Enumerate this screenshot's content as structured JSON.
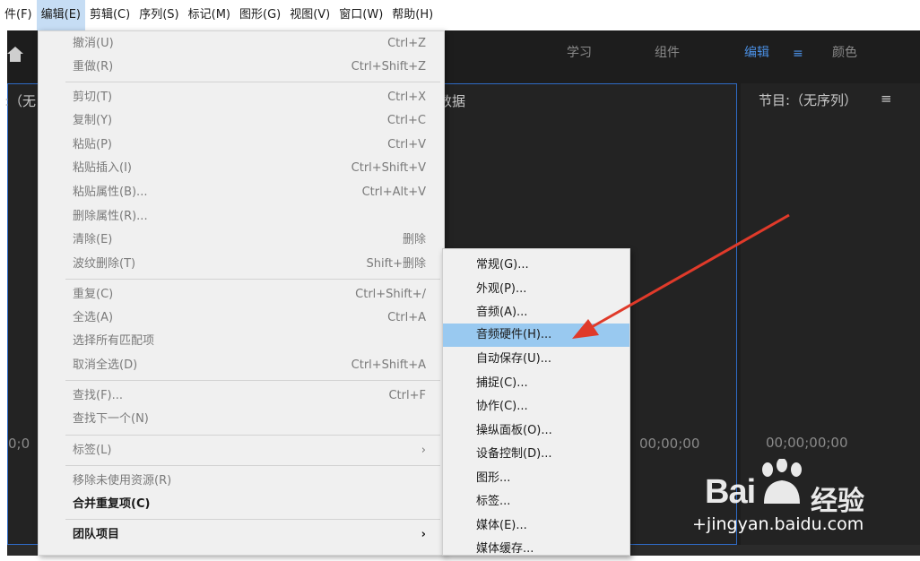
{
  "menubar": [
    "件(F)",
    "编辑(E)",
    "剪辑(C)",
    "序列(S)",
    "标记(M)",
    "图形(G)",
    "视图(V)",
    "窗口(W)",
    "帮助(H)"
  ],
  "workspaces": {
    "learn": "学习",
    "assembly": "组件",
    "editing": "编辑",
    "menu_glyph": "≡",
    "color": "颜色"
  },
  "panels": {
    "source_partial_title": ":（无",
    "metadata_partial": "数据",
    "program_title": "节目:（无序列）",
    "program_menu": "≡",
    "source_tc_left": "0;0",
    "source_tc_right": "00;00;00",
    "program_tc": "00;00;00;00"
  },
  "edit_menu": [
    {
      "label": "撤消(U)",
      "shortcut": "Ctrl+Z",
      "state": "disabled"
    },
    {
      "label": "重做(R)",
      "shortcut": "Ctrl+Shift+Z",
      "state": "disabled"
    },
    {
      "label": "剪切(T)",
      "shortcut": "Ctrl+X",
      "state": "disabled"
    },
    {
      "label": "复制(Y)",
      "shortcut": "Ctrl+C",
      "state": "disabled"
    },
    {
      "label": "粘贴(P)",
      "shortcut": "Ctrl+V",
      "state": "disabled"
    },
    {
      "label": "粘贴插入(I)",
      "shortcut": "Ctrl+Shift+V",
      "state": "disabled"
    },
    {
      "label": "粘贴属性(B)...",
      "shortcut": "Ctrl+Alt+V",
      "state": "disabled"
    },
    {
      "label": "删除属性(R)...",
      "shortcut": "",
      "state": "disabled"
    },
    {
      "label": "清除(E)",
      "shortcut": "删除",
      "state": "disabled"
    },
    {
      "label": "波纹删除(T)",
      "shortcut": "Shift+删除",
      "state": "disabled"
    },
    {
      "label": "重复(C)",
      "shortcut": "Ctrl+Shift+/",
      "state": "disabled"
    },
    {
      "label": "全选(A)",
      "shortcut": "Ctrl+A",
      "state": "disabled"
    },
    {
      "label": "选择所有匹配项",
      "shortcut": "",
      "state": "disabled"
    },
    {
      "label": "取消全选(D)",
      "shortcut": "Ctrl+Shift+A",
      "state": "disabled"
    },
    {
      "label": "查找(F)...",
      "shortcut": "Ctrl+F",
      "state": "disabled"
    },
    {
      "label": "查找下一个(N)",
      "shortcut": "",
      "state": "disabled"
    },
    {
      "label": "标签(L)",
      "shortcut": "›",
      "state": "disabled"
    },
    {
      "label": "移除未使用资源(R)",
      "shortcut": "",
      "state": "disabled"
    },
    {
      "label": "合并重复项(C)",
      "shortcut": "",
      "state": "enabled"
    },
    {
      "label": "团队项目",
      "shortcut": "›",
      "state": "enabled"
    }
  ],
  "preferences_submenu": [
    {
      "label": "常规(G)...",
      "highlighted": false
    },
    {
      "label": "外观(P)...",
      "highlighted": false
    },
    {
      "label": "音频(A)...",
      "highlighted": false
    },
    {
      "label": "音频硬件(H)...",
      "highlighted": true
    },
    {
      "label": "自动保存(U)...",
      "highlighted": false
    },
    {
      "label": "捕捉(C)...",
      "highlighted": false
    },
    {
      "label": "协作(C)...",
      "highlighted": false
    },
    {
      "label": "操纵面板(O)...",
      "highlighted": false
    },
    {
      "label": "设备控制(D)...",
      "highlighted": false
    },
    {
      "label": "图形...",
      "highlighted": false
    },
    {
      "label": "标签...",
      "highlighted": false
    },
    {
      "label": "媒体(E)...",
      "highlighted": false
    },
    {
      "label": "媒体缓存...",
      "highlighted": false
    }
  ],
  "watermark": {
    "logo": "Bai",
    "logo_tail": "经验",
    "url": "jingyan.baidu.com"
  },
  "colors": {
    "menu_bg": "#f0f0f0",
    "highlight": "#99c9f0",
    "accent_blue": "#4a8fe3",
    "arrow": "#e03a2a"
  }
}
